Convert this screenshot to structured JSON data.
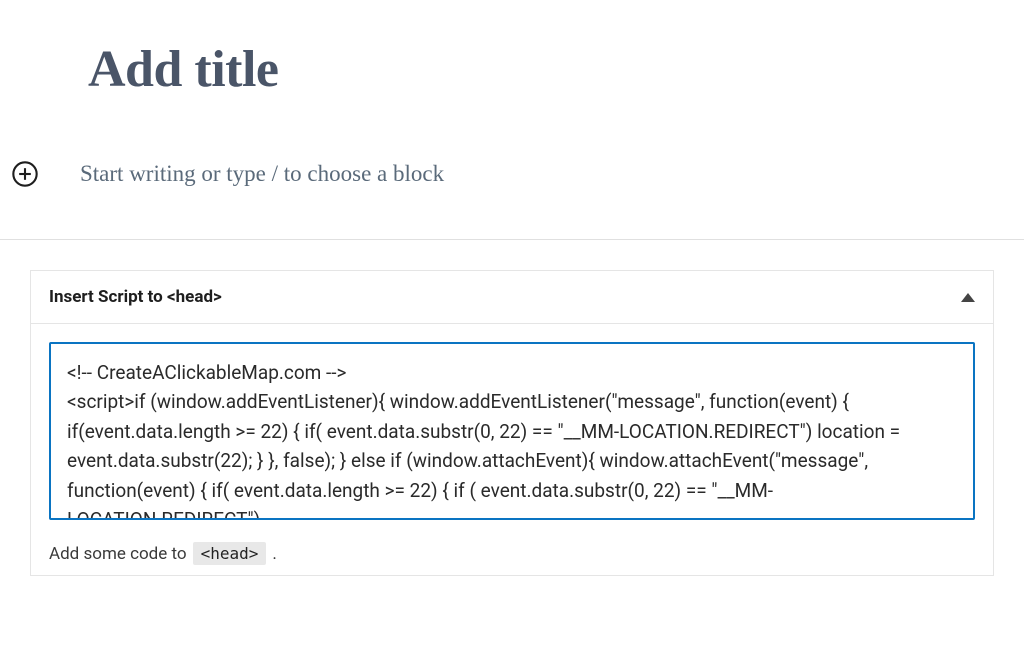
{
  "editor": {
    "title_placeholder": "Add title",
    "content_placeholder": "Start writing or type / to choose a block"
  },
  "panel": {
    "title": "Insert Script to <head>",
    "code_value": "<!-- CreateAClickableMap.com -->\n<script>if (window.addEventListener){ window.addEventListener(\"message\", function(event) { if(event.data.length >= 22) { if( event.data.substr(0, 22) == \"__MM-LOCATION.REDIRECT\") location = event.data.substr(22); } }, false); } else if (window.attachEvent){ window.attachEvent(\"message\", function(event) { if( event.data.length >= 22) { if ( event.data.substr(0, 22) == \"__MM-LOCATION.REDIRECT\")",
    "help_prefix": "Add some code to",
    "help_code": "<head>",
    "help_suffix": "."
  }
}
